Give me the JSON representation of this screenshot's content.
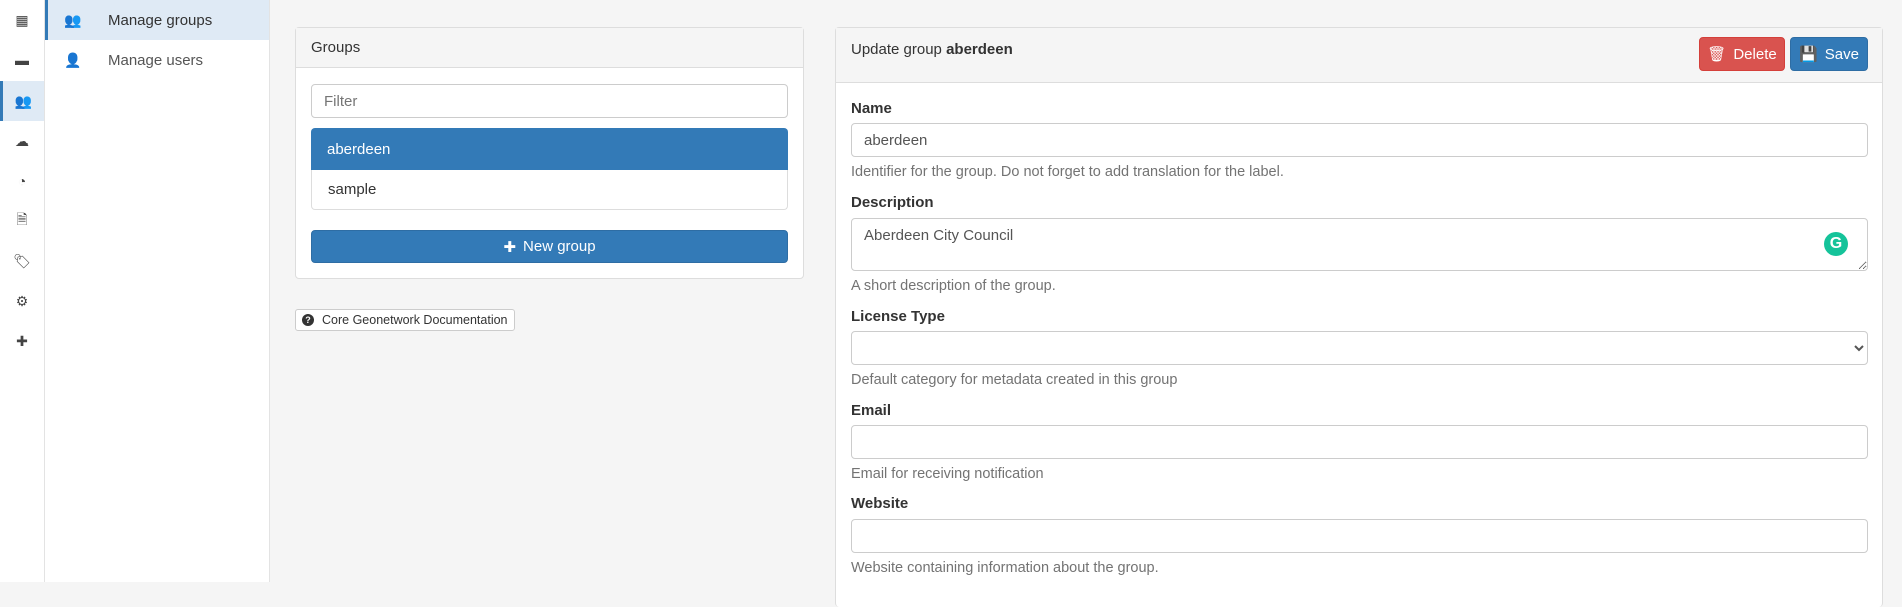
{
  "icon_sidebar": [
    {
      "icon": "grid-icon",
      "glyph": "▦"
    },
    {
      "icon": "archive-icon",
      "glyph": "▬"
    },
    {
      "icon": "users-icon",
      "glyph": "👥",
      "active": true
    },
    {
      "icon": "cloud-download-icon",
      "glyph": "☁"
    },
    {
      "icon": "dashboard-icon",
      "glyph": "◔"
    },
    {
      "icon": "file-icon",
      "glyph": "🗎"
    },
    {
      "icon": "tags-icon",
      "glyph": "🏷"
    },
    {
      "icon": "gear-icon",
      "glyph": "⚙"
    },
    {
      "icon": "medkit-icon",
      "glyph": "✚"
    }
  ],
  "subnav": {
    "items": [
      {
        "label": "Manage groups",
        "active": true
      },
      {
        "label": "Manage users"
      }
    ]
  },
  "groups_panel": {
    "title": "Groups",
    "filter_placeholder": "Filter",
    "items": [
      "aberdeen",
      "sample"
    ],
    "selected": "aberdeen",
    "new_group_label": "New group"
  },
  "docs_button": "Core Geonetwork Documentation",
  "form": {
    "title_prefix": "Update group",
    "title_name": "aberdeen",
    "delete_label": "Delete",
    "save_label": "Save",
    "name_label": "Name",
    "name_value": "aberdeen",
    "name_help": "Identifier for the group. Do not forget to add translation for the label.",
    "description_label": "Description",
    "description_value": "Aberdeen City Council",
    "description_help": "A short description of the group.",
    "license_label": "License Type",
    "license_value": "",
    "license_help": "Default category for metadata created in this group",
    "email_label": "Email",
    "email_value": "",
    "email_help": "Email for receiving notification",
    "website_label": "Website",
    "website_value": "",
    "website_help": "Website containing information about the group."
  },
  "colors": {
    "primary": "#337ab7",
    "danger": "#d9534f",
    "grammarly": "#15c39a"
  }
}
